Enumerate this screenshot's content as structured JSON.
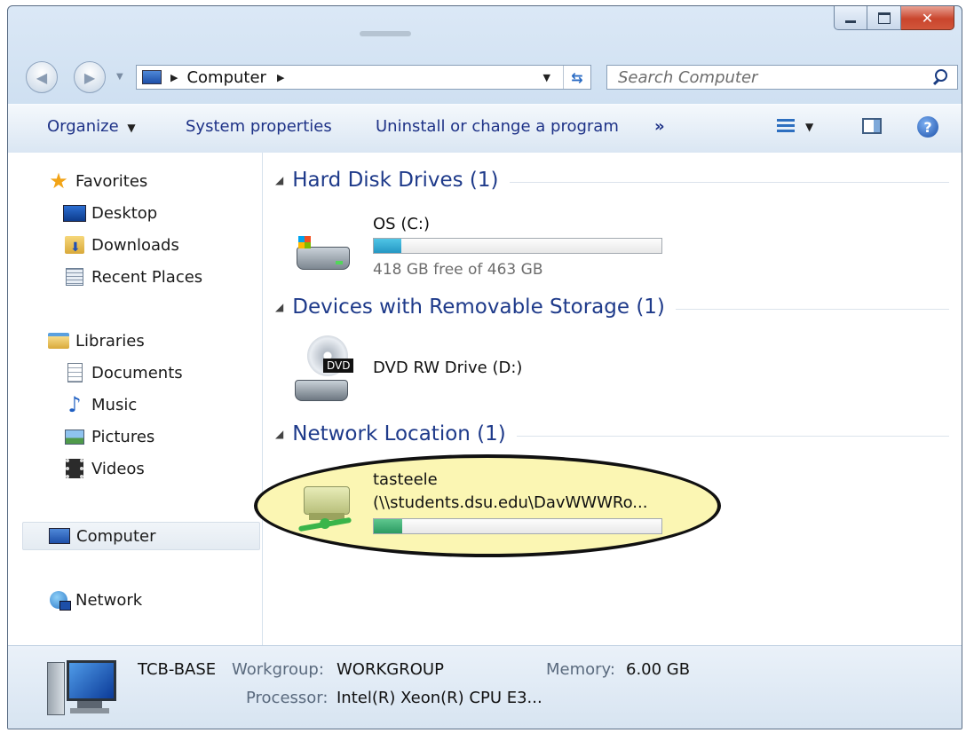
{
  "window": {
    "caption_buttons": {
      "minimize": "minimize-icon",
      "maximize": "maximize-icon",
      "close": "close-icon"
    }
  },
  "address_bar": {
    "crumbs": [
      "Computer"
    ],
    "refresh_icon": "refresh-icon"
  },
  "search": {
    "placeholder": "Search Computer",
    "icon": "search-icon"
  },
  "toolbar": {
    "organize": "Organize",
    "system_properties": "System properties",
    "uninstall": "Uninstall or change a program",
    "more": "»"
  },
  "nav": {
    "favorites": "Favorites",
    "favorites_items": [
      "Desktop",
      "Downloads",
      "Recent Places"
    ],
    "libraries": "Libraries",
    "libraries_items": [
      "Documents",
      "Music",
      "Pictures",
      "Videos"
    ],
    "computer": "Computer",
    "network": "Network"
  },
  "groups": {
    "hdd": "Hard Disk Drives (1)",
    "removable": "Devices with Removable Storage (1)",
    "network": "Network Location (1)"
  },
  "drives": {
    "os": {
      "name": "OS (C:)",
      "free_text": "418 GB free of 463 GB",
      "used_fraction": 0.097
    },
    "dvd": {
      "name": "DVD RW Drive (D:)",
      "badge": "DVD"
    },
    "net": {
      "name": "tasteele",
      "path": "(\\\\students.dsu.edu\\DavWWWRo...",
      "used_fraction": 0.1
    }
  },
  "details": {
    "name": "TCB-BASE",
    "workgroup_label": "Workgroup:",
    "workgroup_value": "WORKGROUP",
    "memory_label": "Memory:",
    "memory_value": "6.00 GB",
    "processor_label": "Processor:",
    "processor_value": "Intel(R) Xeon(R) CPU E3..."
  },
  "colors": {
    "accent": "#1e3a8a",
    "highlight": "#fbf6b3",
    "bar": "#2597c3"
  }
}
